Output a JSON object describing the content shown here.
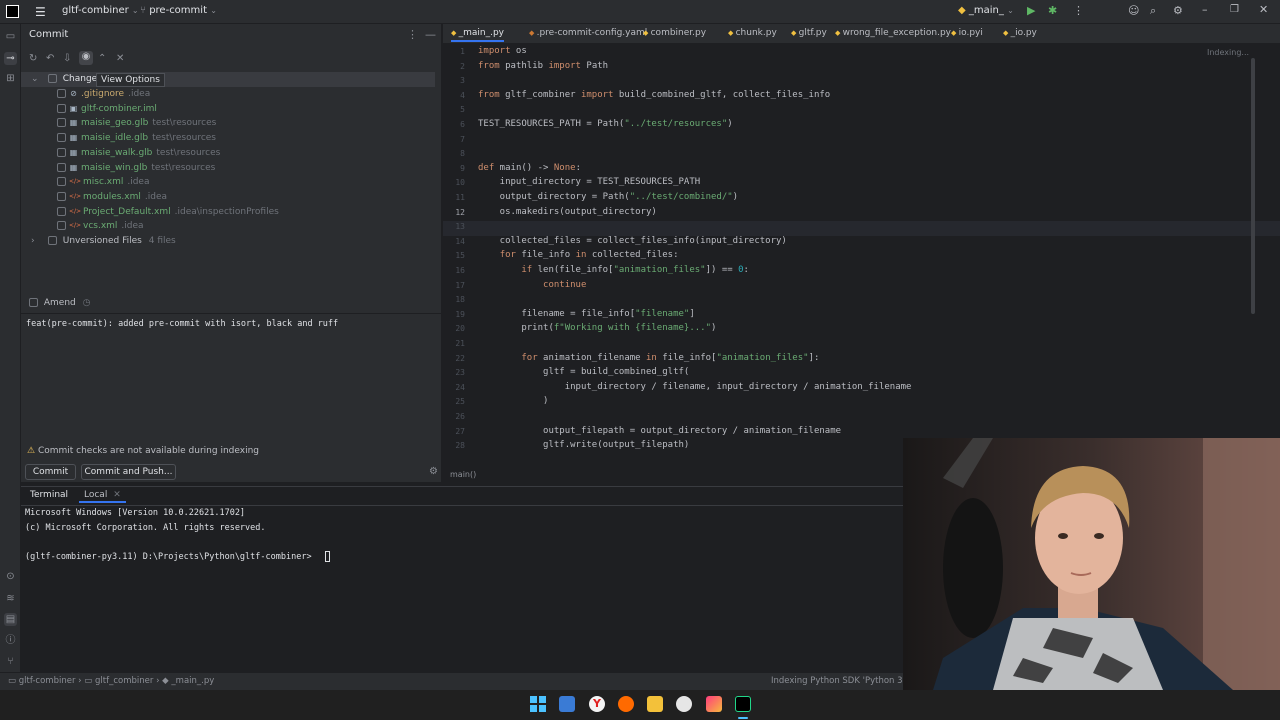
{
  "titlebar": {
    "project": "gltf-combiner",
    "branch": "pre-commit",
    "run_config": "_main_"
  },
  "commit": {
    "title": "Commit",
    "tooltip": "View Options",
    "changes_label": "Changes",
    "files": [
      {
        "name": ".gitignore",
        "dir": ".idea",
        "color": "#c8a96e",
        "icon": "ignore-icon"
      },
      {
        "name": "gltf-combiner.iml",
        "dir": "",
        "color": "#6aab73",
        "icon": "module-file-icon"
      },
      {
        "name": "maisie_geo.glb",
        "dir": "test\\resources",
        "color": "#6aab73",
        "icon": "binary-file-icon"
      },
      {
        "name": "maisie_idle.glb",
        "dir": "test\\resources",
        "color": "#6aab73",
        "icon": "binary-file-icon"
      },
      {
        "name": "maisie_walk.glb",
        "dir": "test\\resources",
        "color": "#6aab73",
        "icon": "binary-file-icon"
      },
      {
        "name": "maisie_win.glb",
        "dir": "test\\resources",
        "color": "#6aab73",
        "icon": "binary-file-icon"
      },
      {
        "name": "misc.xml",
        "dir": ".idea",
        "color": "#6aab73",
        "icon": "xml-file-icon"
      },
      {
        "name": "modules.xml",
        "dir": ".idea",
        "color": "#6aab73",
        "icon": "xml-file-icon"
      },
      {
        "name": "Project_Default.xml",
        "dir": ".idea\\inspectionProfiles",
        "color": "#6aab73",
        "icon": "xml-file-icon"
      },
      {
        "name": "vcs.xml",
        "dir": ".idea",
        "color": "#6aab73",
        "icon": "xml-file-icon"
      }
    ],
    "unversioned_label": "Unversioned Files",
    "unversioned_count": "4 files",
    "amend_label": "Amend",
    "message": "feat(pre-commit): added pre-commit with isort, black and ruff",
    "warning": "Commit checks are not available during indexing",
    "commit_button": "Commit",
    "commit_push_button": "Commit and Push..."
  },
  "editor": {
    "tabs": [
      "_main_.py",
      ".pre-commit-config.yaml",
      "combiner.py",
      "chunk.py",
      "gltf.py",
      "wrong_file_exception.py",
      "io.pyi",
      "_io.py"
    ],
    "indexing": "Indexing...",
    "current_line": "12",
    "breadcrumb": "main()",
    "lines": [
      {
        "n": "1",
        "t": "import os"
      },
      {
        "n": "2",
        "t": "from pathlib import Path"
      },
      {
        "n": "3",
        "t": ""
      },
      {
        "n": "4",
        "t": "from gltf_combiner import build_combined_gltf, collect_files_info"
      },
      {
        "n": "5",
        "t": ""
      },
      {
        "n": "6",
        "t": "TEST_RESOURCES_PATH = Path(\"../test/resources\")"
      },
      {
        "n": "7",
        "t": ""
      },
      {
        "n": "8",
        "t": ""
      },
      {
        "n": "9",
        "t": "def main() -> None:"
      },
      {
        "n": "10",
        "t": "    input_directory = TEST_RESOURCES_PATH"
      },
      {
        "n": "11",
        "t": "    output_directory = Path(\"../test/combined/\")"
      },
      {
        "n": "12",
        "t": "    os.makedirs(output_directory)"
      },
      {
        "n": "13",
        "t": ""
      },
      {
        "n": "14",
        "t": "    collected_files = collect_files_info(input_directory)"
      },
      {
        "n": "15",
        "t": "    for file_info in collected_files:"
      },
      {
        "n": "16",
        "t": "        if len(file_info[\"animation_files\"]) == 0:"
      },
      {
        "n": "17",
        "t": "            continue"
      },
      {
        "n": "18",
        "t": ""
      },
      {
        "n": "19",
        "t": "        filename = file_info[\"filename\"]"
      },
      {
        "n": "20",
        "t": "        print(f\"Working with {filename}...\")"
      },
      {
        "n": "21",
        "t": ""
      },
      {
        "n": "22",
        "t": "        for animation_filename in file_info[\"animation_files\"]:"
      },
      {
        "n": "23",
        "t": "            gltf = build_combined_gltf("
      },
      {
        "n": "24",
        "t": "                input_directory / filename, input_directory / animation_filename"
      },
      {
        "n": "25",
        "t": "            )"
      },
      {
        "n": "26",
        "t": ""
      },
      {
        "n": "27",
        "t": "            output_filepath = output_directory / animation_filename"
      },
      {
        "n": "28",
        "t": "            gltf.write(output_filepath)"
      }
    ]
  },
  "terminal": {
    "tab_terminal": "Terminal",
    "tab_local": "Local",
    "lines": [
      "Microsoft Windows [Version 10.0.22621.1702]",
      "(c) Microsoft Corporation. All rights reserved.",
      "",
      "(gltf-combiner-py3.11) D:\\Projects\\Python\\gltf-combiner>"
    ]
  },
  "statusbar": {
    "crumbs": [
      "gltf-combiner",
      "gltf_combiner",
      "_main_.py"
    ],
    "indexing": "Indexing Python SDK 'Python 3.11 ("
  },
  "colors": {
    "accent": "#3574f0",
    "added": "#6aab73",
    "ignored": "#c8a96e"
  }
}
